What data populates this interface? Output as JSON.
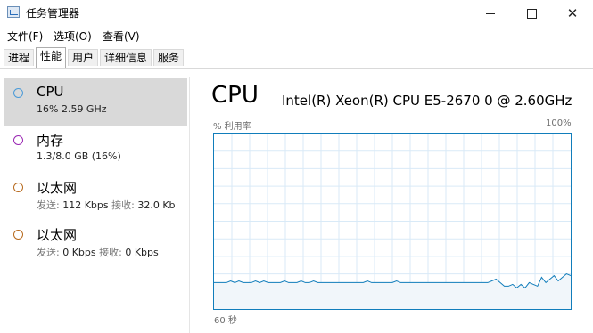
{
  "window": {
    "title": "任务管理器"
  },
  "menu": [
    "文件(F)",
    "选项(O)",
    "查看(V)"
  ],
  "tabs": [
    "进程",
    "性能",
    "用户",
    "详细信息",
    "服务"
  ],
  "active_tab": "性能",
  "sidebar": {
    "items": [
      {
        "name": "CPU",
        "detail": "16% 2.59 GHz",
        "ring_color": "#4a9ad8",
        "selected": true
      },
      {
        "name": "内存",
        "detail": "1.3/8.0 GB (16%)",
        "ring_color": "#9a27b3"
      },
      {
        "name": "以太网",
        "send_label": "发送:",
        "send_value": "112 Kbps",
        "recv_label": "接收:",
        "recv_value": "32.0 Kb",
        "ring_color": "#b76a1e"
      },
      {
        "name": "以太网",
        "send_label": "发送:",
        "send_value": "0 Kbps",
        "recv_label": "接收:",
        "recv_value": "0 Kbps",
        "ring_color": "#b76a1e"
      }
    ]
  },
  "detail": {
    "title": "CPU",
    "model": "Intel(R) Xeon(R) CPU E5-2670 0 @ 2.60GHz",
    "y_label": "% 利用率",
    "y_max_label": "100%",
    "x_label": "60 秒"
  },
  "chart_data": {
    "type": "area",
    "ylim": [
      0,
      100
    ],
    "grid": true,
    "series": [
      {
        "values": [
          15,
          15,
          15,
          15,
          16,
          15,
          16,
          15,
          15,
          15,
          16,
          15,
          16,
          15,
          15,
          15,
          15,
          16,
          15,
          15,
          15,
          16,
          15,
          15,
          16,
          15,
          15,
          15,
          15,
          15,
          15,
          15,
          15,
          15,
          15,
          15,
          15,
          16,
          15,
          15,
          15,
          15,
          15,
          15,
          16,
          15,
          15,
          15,
          15,
          15,
          15,
          15,
          15,
          15,
          15,
          15,
          15,
          15,
          15,
          15,
          15,
          15,
          15,
          15,
          15,
          15,
          15,
          16,
          17,
          15,
          13,
          13,
          14,
          12,
          14,
          12,
          15,
          14,
          13,
          18,
          15,
          17,
          19,
          16,
          18,
          20,
          19
        ]
      }
    ],
    "color": "#117dbb"
  }
}
